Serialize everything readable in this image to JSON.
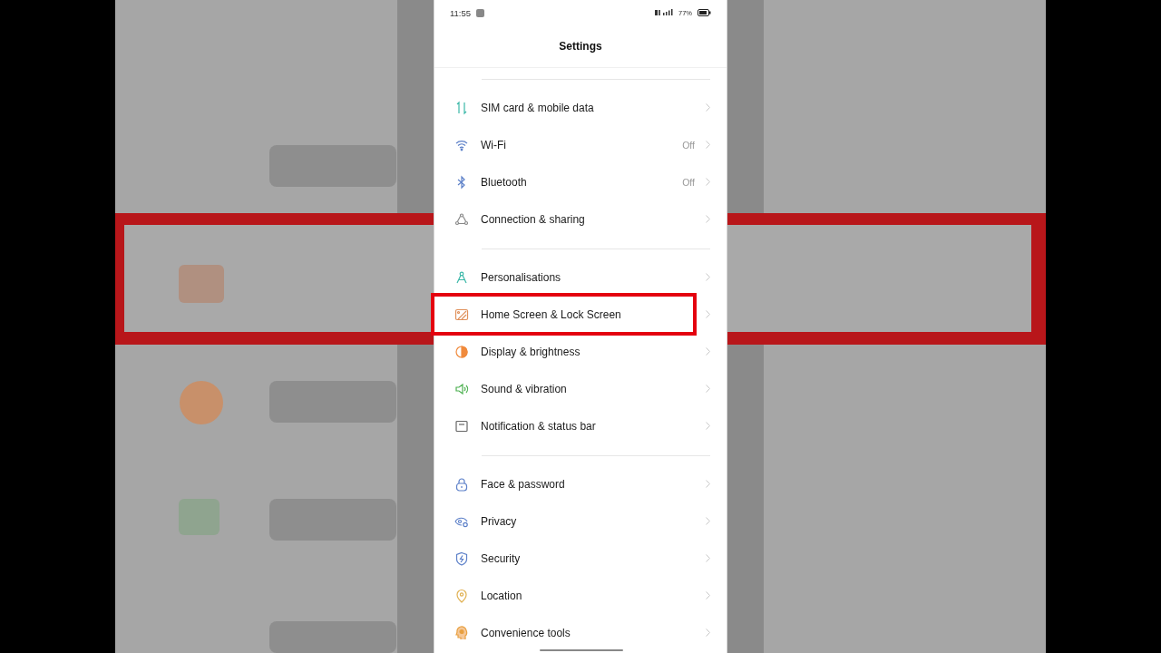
{
  "status_bar": {
    "time": "11:55",
    "battery": "77%"
  },
  "header": {
    "title": "Settings"
  },
  "groups": [
    {
      "items": [
        {
          "label": "SIM card & mobile data",
          "highlighted": false
        },
        {
          "label": "Wi-Fi",
          "value": "Off",
          "highlighted": false
        },
        {
          "label": "Bluetooth",
          "value": "Off",
          "highlighted": false
        },
        {
          "label": "Connection & sharing",
          "highlighted": false
        }
      ]
    },
    {
      "items": [
        {
          "label": "Personalisations",
          "highlighted": false
        },
        {
          "label": "Home Screen & Lock Screen",
          "highlighted": true
        },
        {
          "label": "Display & brightness",
          "highlighted": false
        },
        {
          "label": "Sound & vibration",
          "highlighted": false
        },
        {
          "label": "Notification & status bar",
          "highlighted": false
        }
      ]
    },
    {
      "items": [
        {
          "label": "Face & password",
          "highlighted": false
        },
        {
          "label": "Privacy",
          "highlighted": false
        },
        {
          "label": "Security",
          "highlighted": false
        },
        {
          "label": "Location",
          "highlighted": false
        },
        {
          "label": "Convenience tools",
          "highlighted": false
        }
      ]
    }
  ]
}
